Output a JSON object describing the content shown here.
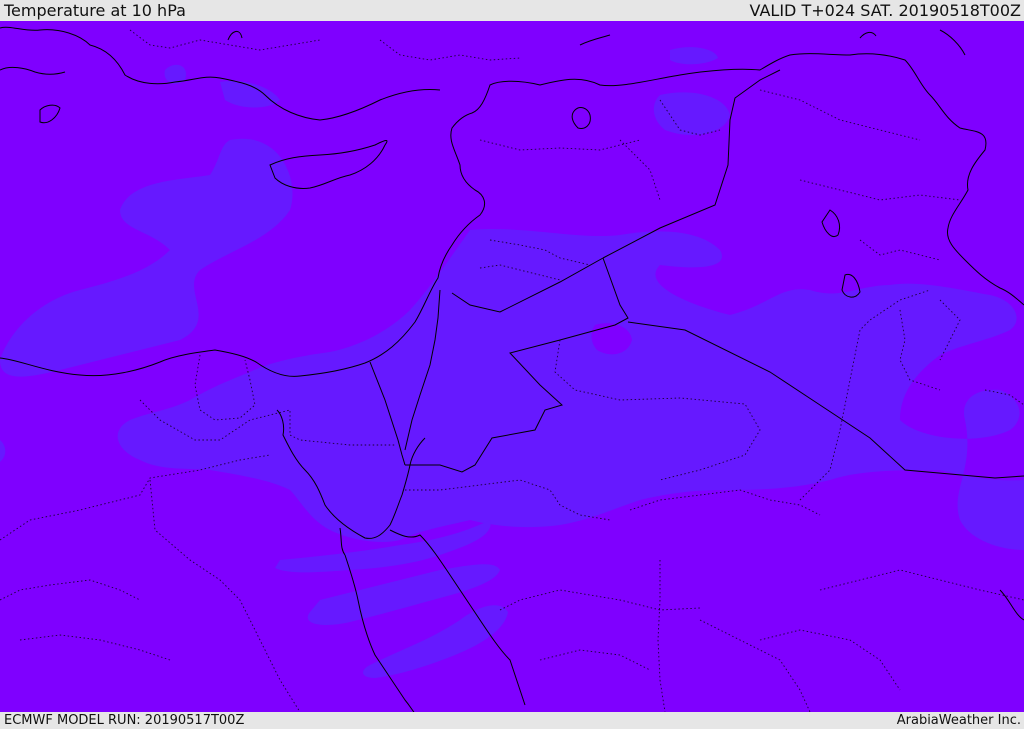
{
  "header": {
    "title": "Temperature at 10 hPa",
    "valid": "VALID T+024 SAT. 20190518T00Z"
  },
  "footer": {
    "model_run": "ECMWF MODEL RUN: 20190517T00Z",
    "credit": "ArabiaWeather Inc."
  },
  "map": {
    "colors": {
      "background_field": "#7f00ff",
      "cooler_field": "#6619ff",
      "coastline": "#000000"
    }
  }
}
